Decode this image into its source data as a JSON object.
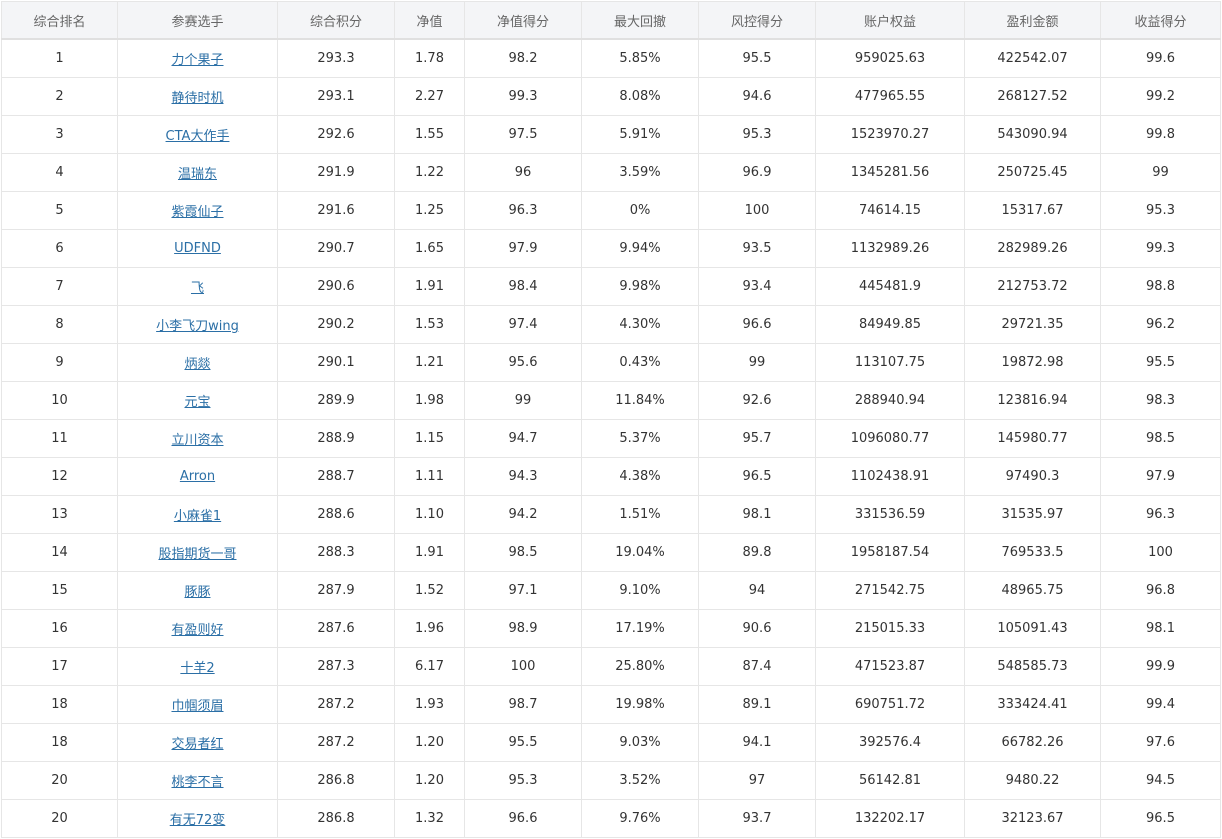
{
  "table": {
    "headers": [
      "综合排名",
      "参赛选手",
      "综合积分",
      "净值",
      "净值得分",
      "最大回撤",
      "风控得分",
      "账户权益",
      "盈利金额",
      "收益得分"
    ],
    "rows": [
      [
        "1",
        "力个果子",
        "293.3",
        "1.78",
        "98.2",
        "5.85%",
        "95.5",
        "959025.63",
        "422542.07",
        "99.6"
      ],
      [
        "2",
        "静待时机",
        "293.1",
        "2.27",
        "99.3",
        "8.08%",
        "94.6",
        "477965.55",
        "268127.52",
        "99.2"
      ],
      [
        "3",
        "CTA大作手",
        "292.6",
        "1.55",
        "97.5",
        "5.91%",
        "95.3",
        "1523970.27",
        "543090.94",
        "99.8"
      ],
      [
        "4",
        "温瑞东",
        "291.9",
        "1.22",
        "96",
        "3.59%",
        "96.9",
        "1345281.56",
        "250725.45",
        "99"
      ],
      [
        "5",
        "紫霞仙子",
        "291.6",
        "1.25",
        "96.3",
        "0%",
        "100",
        "74614.15",
        "15317.67",
        "95.3"
      ],
      [
        "6",
        "UDFND",
        "290.7",
        "1.65",
        "97.9",
        "9.94%",
        "93.5",
        "1132989.26",
        "282989.26",
        "99.3"
      ],
      [
        "7",
        "飞",
        "290.6",
        "1.91",
        "98.4",
        "9.98%",
        "93.4",
        "445481.9",
        "212753.72",
        "98.8"
      ],
      [
        "8",
        "小李飞刀wing",
        "290.2",
        "1.53",
        "97.4",
        "4.30%",
        "96.6",
        "84949.85",
        "29721.35",
        "96.2"
      ],
      [
        "9",
        "炳燚",
        "290.1",
        "1.21",
        "95.6",
        "0.43%",
        "99",
        "113107.75",
        "19872.98",
        "95.5"
      ],
      [
        "10",
        "元宝",
        "289.9",
        "1.98",
        "99",
        "11.84%",
        "92.6",
        "288940.94",
        "123816.94",
        "98.3"
      ],
      [
        "11",
        "立川资本",
        "288.9",
        "1.15",
        "94.7",
        "5.37%",
        "95.7",
        "1096080.77",
        "145980.77",
        "98.5"
      ],
      [
        "12",
        "Arron",
        "288.7",
        "1.11",
        "94.3",
        "4.38%",
        "96.5",
        "1102438.91",
        "97490.3",
        "97.9"
      ],
      [
        "13",
        "小麻雀1",
        "288.6",
        "1.10",
        "94.2",
        "1.51%",
        "98.1",
        "331536.59",
        "31535.97",
        "96.3"
      ],
      [
        "14",
        "股指期货一哥",
        "288.3",
        "1.91",
        "98.5",
        "19.04%",
        "89.8",
        "1958187.54",
        "769533.5",
        "100"
      ],
      [
        "15",
        "豚豚",
        "287.9",
        "1.52",
        "97.1",
        "9.10%",
        "94",
        "271542.75",
        "48965.75",
        "96.8"
      ],
      [
        "16",
        "有盈则好",
        "287.6",
        "1.96",
        "98.9",
        "17.19%",
        "90.6",
        "215015.33",
        "105091.43",
        "98.1"
      ],
      [
        "17",
        "十羊2",
        "287.3",
        "6.17",
        "100",
        "25.80%",
        "87.4",
        "471523.87",
        "548585.73",
        "99.9"
      ],
      [
        "18",
        "巾帼须眉",
        "287.2",
        "1.93",
        "98.7",
        "19.98%",
        "89.1",
        "690751.72",
        "333424.41",
        "99.4"
      ],
      [
        "18",
        "交易者红",
        "287.2",
        "1.20",
        "95.5",
        "9.03%",
        "94.1",
        "392576.4",
        "66782.26",
        "97.6"
      ],
      [
        "20",
        "桃李不言",
        "286.8",
        "1.20",
        "95.3",
        "3.52%",
        "97",
        "56142.81",
        "9480.22",
        "94.5"
      ],
      [
        "20",
        "有无72变",
        "286.8",
        "1.32",
        "96.6",
        "9.76%",
        "93.7",
        "132202.17",
        "32123.67",
        "96.5"
      ]
    ]
  },
  "colors": {
    "header_bg": "#f4f5f7",
    "border": "#e6e6e6",
    "link": "#2b6fa6",
    "text": "#333333"
  }
}
